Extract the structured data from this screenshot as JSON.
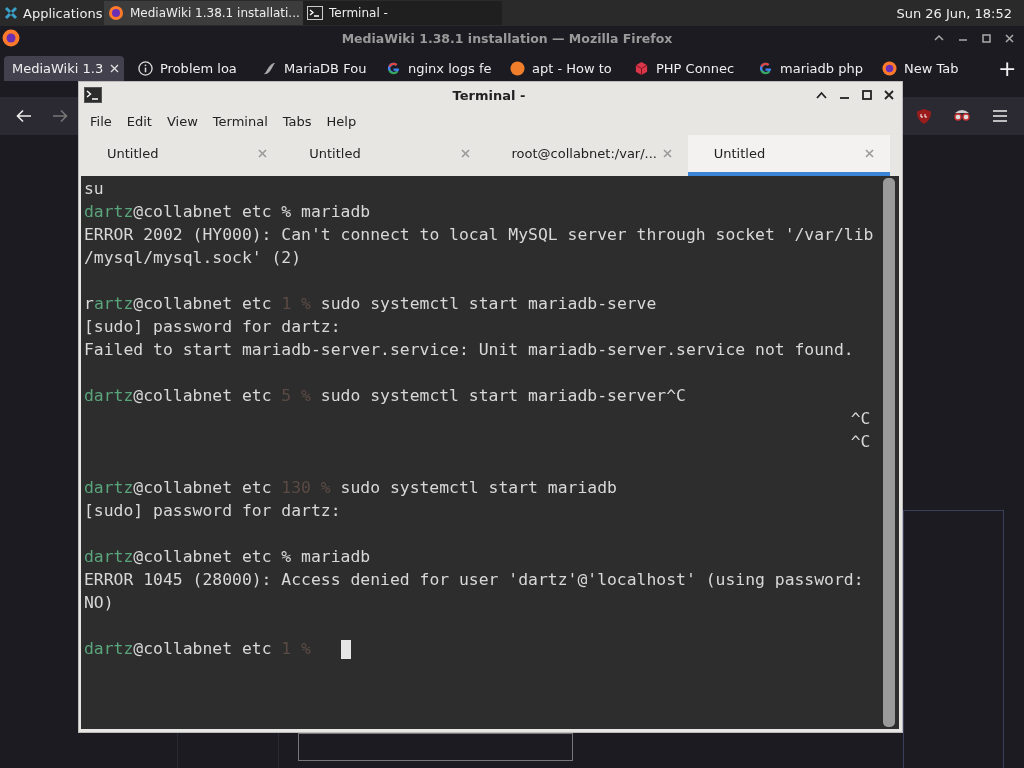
{
  "top_panel": {
    "menu_label": "Applications",
    "tasks": [
      {
        "label": "MediaWiki 1.38.1 installati...",
        "selected": true
      },
      {
        "label": "Terminal -",
        "selected": false
      }
    ],
    "clock": "Sun 26 Jun, 18:52"
  },
  "browser": {
    "title": "MediaWiki 1.38.1 installation — Mozilla Firefox",
    "tabs": [
      {
        "label": "MediaWiki 1.3",
        "selected": true
      },
      {
        "label": "Problem loa",
        "selected": false
      },
      {
        "label": "MariaDB Fou",
        "selected": false
      },
      {
        "label": "nginx logs fe",
        "selected": false
      },
      {
        "label": "apt - How to",
        "selected": false
      },
      {
        "label": "PHP Connec",
        "selected": false
      },
      {
        "label": "mariadb php",
        "selected": false
      },
      {
        "label": "New Tab",
        "selected": false
      }
    ],
    "new_tab": "+"
  },
  "terminal": {
    "title": "Terminal -",
    "menu": [
      "File",
      "Edit",
      "View",
      "Terminal",
      "Tabs",
      "Help"
    ],
    "tabs": [
      {
        "label": "Untitled",
        "selected": false
      },
      {
        "label": "Untitled",
        "selected": false
      },
      {
        "label": "root@collabnet:/var/...",
        "selected": false
      },
      {
        "label": "Untitled",
        "selected": true
      }
    ],
    "lines": [
      {
        "kind": "text",
        "segments": [
          {
            "kind": "plain",
            "text": "su"
          }
        ]
      },
      {
        "kind": "text",
        "segments": [
          {
            "kind": "user",
            "text": "dartz"
          },
          {
            "kind": "plain",
            "text": "@collabnet etc % mariadb"
          }
        ]
      },
      {
        "kind": "text",
        "segments": [
          {
            "kind": "plain",
            "text": "ERROR 2002 (HY000): Can't connect to local MySQL server through socket '/var/lib"
          }
        ]
      },
      {
        "kind": "text",
        "segments": [
          {
            "kind": "plain",
            "text": "/mysql/mysql.sock' (2)"
          }
        ]
      },
      {
        "kind": "blank"
      },
      {
        "kind": "text",
        "segments": [
          {
            "kind": "plain",
            "text": "r"
          },
          {
            "kind": "user",
            "text": "artz"
          },
          {
            "kind": "plain",
            "text": "@collabnet etc"
          },
          {
            "kind": "status",
            "text": "1 %"
          },
          {
            "kind": "plain",
            "text": "sudo systemctl start mariadb-serve"
          }
        ]
      },
      {
        "kind": "text",
        "segments": [
          {
            "kind": "plain",
            "text": "[sudo] password for dartz:"
          }
        ]
      },
      {
        "kind": "text",
        "segments": [
          {
            "kind": "plain",
            "text": "Failed to start mariadb-server.service: Unit mariadb-server.service not found."
          }
        ]
      },
      {
        "kind": "blank"
      },
      {
        "kind": "text",
        "segments": [
          {
            "kind": "user",
            "text": "dartz"
          },
          {
            "kind": "plain",
            "text": "@collabnet etc"
          },
          {
            "kind": "status",
            "text": "5 %"
          },
          {
            "kind": "plain",
            "text": "sudo systemctl start mariadb-server^C"
          }
        ]
      },
      {
        "kind": "right",
        "segments": [
          {
            "kind": "plain",
            "text": "^C"
          }
        ]
      },
      {
        "kind": "right",
        "segments": [
          {
            "kind": "plain",
            "text": "^C"
          }
        ]
      },
      {
        "kind": "blank"
      },
      {
        "kind": "text",
        "segments": [
          {
            "kind": "user",
            "text": "dartz"
          },
          {
            "kind": "plain",
            "text": "@collabnet etc"
          },
          {
            "kind": "status",
            "text": "130 %"
          },
          {
            "kind": "plain",
            "text": "sudo systemctl start mariadb"
          }
        ]
      },
      {
        "kind": "text",
        "segments": [
          {
            "kind": "plain",
            "text": "[sudo] password for dartz:"
          }
        ]
      },
      {
        "kind": "blank"
      },
      {
        "kind": "text",
        "segments": [
          {
            "kind": "user",
            "text": "dartz"
          },
          {
            "kind": "plain",
            "text": "@collabnet etc % mariadb"
          }
        ]
      },
      {
        "kind": "text",
        "segments": [
          {
            "kind": "plain",
            "text": "ERROR 1045 (28000): Access denied for user 'dartz'@'localhost' (using password:"
          }
        ]
      },
      {
        "kind": "text",
        "segments": [
          {
            "kind": "plain",
            "text": "NO)"
          }
        ]
      },
      {
        "kind": "blank"
      },
      {
        "kind": "text",
        "cursor": true,
        "segments": [
          {
            "kind": "user",
            "text": "dartz"
          },
          {
            "kind": "plain",
            "text": "@collabnet etc"
          },
          {
            "kind": "status",
            "text": "1 %"
          }
        ]
      }
    ]
  }
}
